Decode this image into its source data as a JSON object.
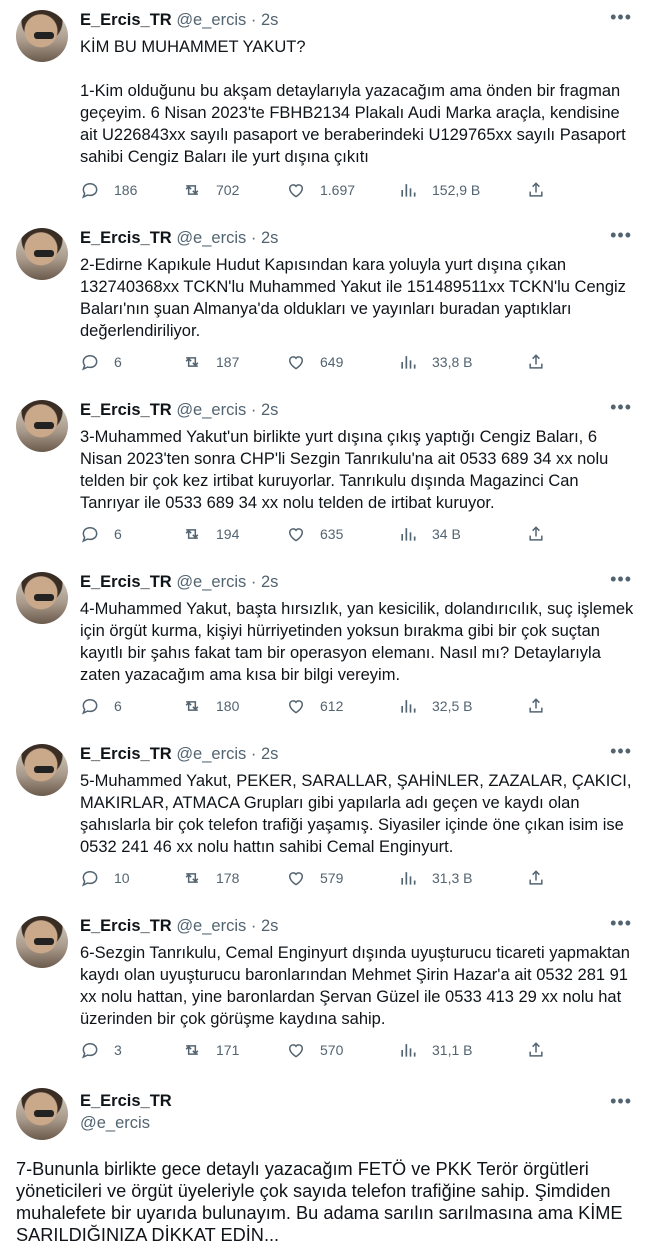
{
  "author": {
    "name": "E_Ercis_TR",
    "handle": "@e_ercis",
    "dot": "·",
    "time": "2s"
  },
  "more_glyph": "•••",
  "tweets": [
    {
      "text": "KİM BU MUHAMMET YAKUT?\n\n1-Kim olduğunu bu akşam detaylarıyla yazacağım ama önden bir fragman geçeyim. 6 Nisan 2023'te FBHB2134 Plakalı Audi Marka araçla, kendisine ait U226843xx sayılı pasaport ve beraberindeki U129765xx sayılı Pasaport sahibi Cengiz Baları ile yurt dışına çıkıtı",
      "replies": "186",
      "retweets": "702",
      "likes": "1.697",
      "views": "152,9 B"
    },
    {
      "text": "2-Edirne Kapıkule Hudut Kapısından kara yoluyla yurt dışına çıkan 132740368xx TCKN'lu Muhammed Yakut ile 151489511xx TCKN'lu Cengiz Baları'nın şuan Almanya'da oldukları ve yayınları buradan yaptıkları değerlendiriliyor.",
      "replies": "6",
      "retweets": "187",
      "likes": "649",
      "views": "33,8 B"
    },
    {
      "text": "3-Muhammed Yakut'un birlikte yurt dışına çıkış yaptığı Cengiz Baları, 6 Nisan 2023'ten sonra CHP'li Sezgin Tanrıkulu'na ait 0533 689 34 xx nolu telden bir çok kez irtibat kuruyorlar. Tanrıkulu dışında Magazinci Can Tanrıyar ile 0533 689 34 xx nolu telden de irtibat kuruyor.",
      "replies": "6",
      "retweets": "194",
      "likes": "635",
      "views": "34 B"
    },
    {
      "text": "4-Muhammed Yakut, başta hırsızlık, yan kesicilik, dolandırıcılık, suç işlemek için örgüt kurma, kişiyi hürriyetinden yoksun bırakma gibi bir çok suçtan kayıtlı bir şahıs fakat tam bir operasyon elemanı. Nasıl mı? Detaylarıyla zaten yazacağım ama kısa bir bilgi vereyim.",
      "replies": "6",
      "retweets": "180",
      "likes": "612",
      "views": "32,5 B"
    },
    {
      "text": "5-Muhammed Yakut, PEKER, SARALLAR, ŞAHİNLER, ZAZALAR, ÇAKICI, MAKIRLAR, ATMACA Grupları gibi yapılarla adı geçen ve kaydı olan şahıslarla bir çok telefon trafiği yaşamış. Siyasiler içinde öne çıkan isim ise 0532 241 46 xx nolu hattın sahibi Cemal Enginyurt.",
      "replies": "10",
      "retweets": "178",
      "likes": "579",
      "views": "31,3 B"
    },
    {
      "text": "6-Sezgin Tanrıkulu, Cemal Enginyurt dışında uyuşturucu ticareti yapmaktan kaydı olan uyuşturucu baronlarından Mehmet Şirin Hazar'a ait 0532 281 91 xx nolu hattan, yine baronlardan Şervan Güzel ile 0533 413 29 xx nolu hat üzerinden bir çok görüşme kaydına sahip.",
      "replies": "3",
      "retweets": "171",
      "likes": "570",
      "views": "31,1 B"
    }
  ],
  "last_tweet": {
    "text": "7-Bununla birlikte gece detaylı yazacağım FETÖ ve PKK Terör örgütleri yöneticileri ve örgüt üyeleriyle çok sayıda telefon trafiğine sahip. Şimdiden muhalefete bir uyarıda bulunayım. Bu adama sarılın sarılmasına ama KİME SARILDIĞINIZA DİKKAT EDİN..."
  }
}
